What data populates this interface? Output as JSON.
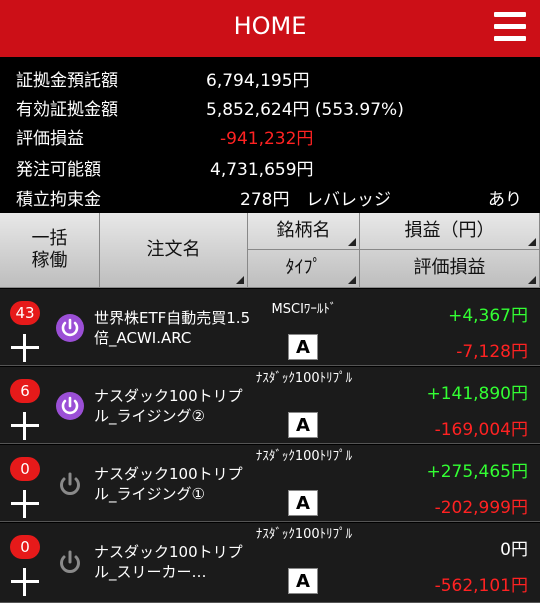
{
  "header": {
    "title": "HOME"
  },
  "summary": {
    "margin_deposit": {
      "label": "証拠金預託額",
      "value": "6,794,195円"
    },
    "effective_margin": {
      "label": "有効証拠金額",
      "value": "5,852,624円 (553.97%)"
    },
    "valuation_pl": {
      "label": "評価損益",
      "value": "-941,232円"
    },
    "available_to_order": {
      "label": "発注可能額",
      "value": "4,731,659円"
    },
    "accumulated_restraint": {
      "label": "積立拘束金",
      "value": "278円",
      "leverage_label": "レバレッジ",
      "leverage_value": "あり"
    }
  },
  "table_header": {
    "bulk_run": "一括\n稼働",
    "order_name": "注文名",
    "symbol": "銘柄名",
    "type": "ﾀｲﾌﾟ",
    "profit": "損益（円）",
    "valuation": "評価損益"
  },
  "orders": [
    {
      "count": "43",
      "active": true,
      "name": "世界株ETF自動売買1.5倍_ACWI.ARC",
      "symbol": "MSCIﾜｰﾙﾄﾞ",
      "type": "A",
      "profit": "+4,367円",
      "valuation": "-7,128円"
    },
    {
      "count": "6",
      "active": true,
      "name": "ナスダック100トリプル_ライジング②",
      "symbol": "ﾅｽﾀﾞｯｸ100ﾄﾘﾌﾟﾙ",
      "type": "A",
      "profit": "+141,890円",
      "valuation": "-169,004円"
    },
    {
      "count": "0",
      "active": false,
      "name": "ナスダック100トリプル_ライジング①",
      "symbol": "ﾅｽﾀﾞｯｸ100ﾄﾘﾌﾟﾙ",
      "type": "A",
      "profit": "+275,465円",
      "valuation": "-202,999円"
    },
    {
      "count": "0",
      "active": false,
      "name": "ナスダック100トリプル_スリーカー…",
      "symbol": "ﾅｽﾀﾞｯｸ100ﾄﾘﾌﾟﾙ",
      "type": "A",
      "profit": "0円",
      "valuation": "-562,101円"
    }
  ],
  "colors": {
    "header_bg": "#cc0f17",
    "positive": "#33ff33",
    "negative": "#ff2222",
    "active_power": "#9b4fd6",
    "inactive_power": "#8a8a8a"
  }
}
